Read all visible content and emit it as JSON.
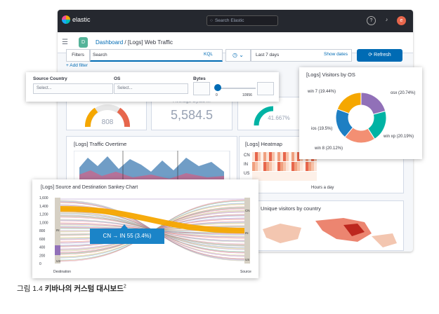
{
  "app": {
    "name": "elastic",
    "search_placeholder": "Search Elastic"
  },
  "breadcrumb": {
    "badge": "D",
    "root": "Dashboard",
    "sep": "/",
    "current": "[Logs] Web Traffic"
  },
  "query_bar": {
    "filters_label": "Filters",
    "search_placeholder": "Search",
    "kql": "KQL",
    "date_range": "Last 7 days",
    "show_dates": "Show dates",
    "refresh": "Refresh",
    "add_filter": "+ Add filter"
  },
  "controls": {
    "source_country": {
      "label": "Source Country",
      "placeholder": "Select..."
    },
    "os": {
      "label": "OS",
      "placeholder": "Select..."
    },
    "bytes": {
      "label": "Bytes",
      "min": "0",
      "max": "10956",
      "value_fraction": 0.0
    }
  },
  "metrics": {
    "gauge_value": "808",
    "avg_bytes_label": "Average Bytes In",
    "avg_bytes_value": "5,584.5",
    "percent_value": "41.667%"
  },
  "panels": {
    "traffic_title": "[Logs] Traffic Overtime",
    "heatmap_title": "[Logs] Heatmap",
    "heatmap_rows": [
      "CN",
      "IN",
      "US"
    ],
    "heatmap_xlabel": "Hours a day",
    "unique_title": "Unique visitors by country"
  },
  "os_chart": {
    "title": "[Logs] Visitors by OS",
    "slices": [
      {
        "label": "osx (20.74%)",
        "value": 20.74,
        "color": "#9170b8"
      },
      {
        "label": "win xp (20.19%)",
        "value": 20.19,
        "color": "#00b3a4"
      },
      {
        "label": "win 8 (20.12%)",
        "value": 20.12,
        "color": "#f38f73"
      },
      {
        "label": "ios (19.5%)",
        "value": 19.5,
        "color": "#1e7fc3"
      },
      {
        "label": "win 7 (19.44%)",
        "value": 19.44,
        "color": "#f5a700"
      }
    ]
  },
  "sankey": {
    "title": "[Logs] Source and Destination Sankey Chart",
    "y_ticks": [
      "1,600",
      "1,400",
      "1,200",
      "1,000",
      "800",
      "600",
      "400",
      "200",
      "0"
    ],
    "left_nodes": [
      "IN",
      "US"
    ],
    "right_nodes": [
      "CN",
      "IN",
      "US"
    ],
    "tooltip": "CN → IN 55 (3.4%)",
    "dest_label": "Destination",
    "source_label": "Source"
  },
  "caption": {
    "prefix": "그림 1.4 ",
    "text": "키바나의 커스텀 대시보드",
    "sup": "2"
  }
}
